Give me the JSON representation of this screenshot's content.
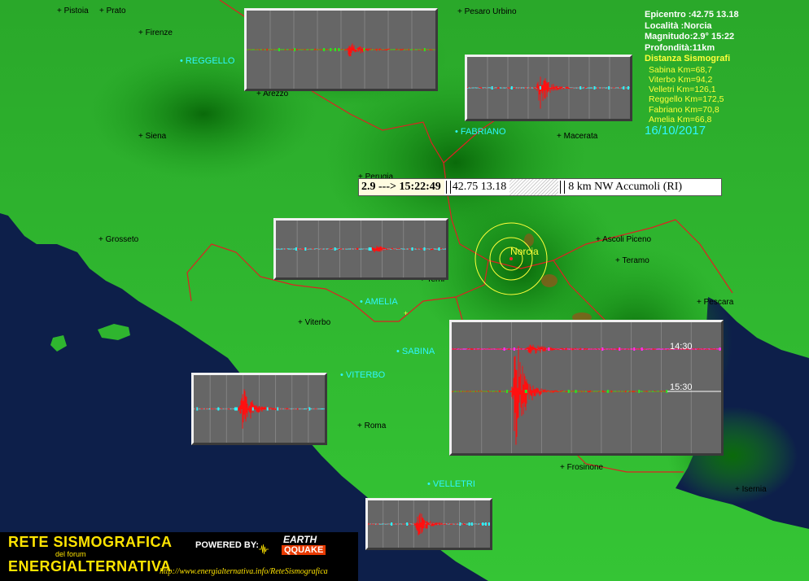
{
  "info": {
    "epicentro": "Epicentro :42.75 13.18",
    "localita": "Località :Norcia",
    "magnitudo": "Magnitudo:2.9° 15:22",
    "profondita": "Profondità:11km",
    "distanza_title": "Distanza Sismografi",
    "distances": [
      "Sabina Km=68,7",
      "Viterbo Km=94,2",
      "Velletri Km=126,1",
      "Reggello Km=172,5",
      "Fabriano Km=70,8",
      "Amelia Km=66,8"
    ],
    "date": "16/10/2017"
  },
  "event_bar": {
    "magnitude_time": "2.9 ---> 15:22:49",
    "coordinates": "42.75 13.18",
    "location": "8 km NW Accumoli (RI)"
  },
  "cities": [
    {
      "name": "Pistoia"
    },
    {
      "name": "Prato"
    },
    {
      "name": "Firenze"
    },
    {
      "name": "Arezzo"
    },
    {
      "name": "Siena"
    },
    {
      "name": "Perugia"
    },
    {
      "name": "Grosseto"
    },
    {
      "name": "Pesaro Urbino"
    },
    {
      "name": "Macerata"
    },
    {
      "name": "Ascoli Piceno"
    },
    {
      "name": "Teramo"
    },
    {
      "name": "Pescara"
    },
    {
      "name": "Terni"
    },
    {
      "name": "Viterbo"
    },
    {
      "name": "Roma"
    },
    {
      "name": "Frosinone"
    },
    {
      "name": "Isernia"
    }
  ],
  "stations": [
    {
      "name": "REGGELLO"
    },
    {
      "name": "FABRIANO"
    },
    {
      "name": "AMELIA"
    },
    {
      "name": "SABINA"
    },
    {
      "name": "VITERBO"
    },
    {
      "name": "VELLETRI"
    }
  ],
  "epicenter_label": "Norcia",
  "seismo_times": [
    "14:30",
    "15:30"
  ],
  "logo": {
    "line1": "RETE SISMOGRAFICA",
    "line2": "del forum",
    "line3": "ENERGIALTERNATIVA",
    "powered": "POWERED BY:",
    "earth": "EARTH",
    "qquake": "QQUAKE",
    "url": "http://www.energialternativa.info/ReteSismografica"
  },
  "colors": {
    "sea": "#0d1f4a",
    "land": "#2fbf2f",
    "station": "#2ef6ff",
    "info_yellow": "#ffff3a",
    "trace_red": "#ff1010",
    "border": "#d22"
  }
}
